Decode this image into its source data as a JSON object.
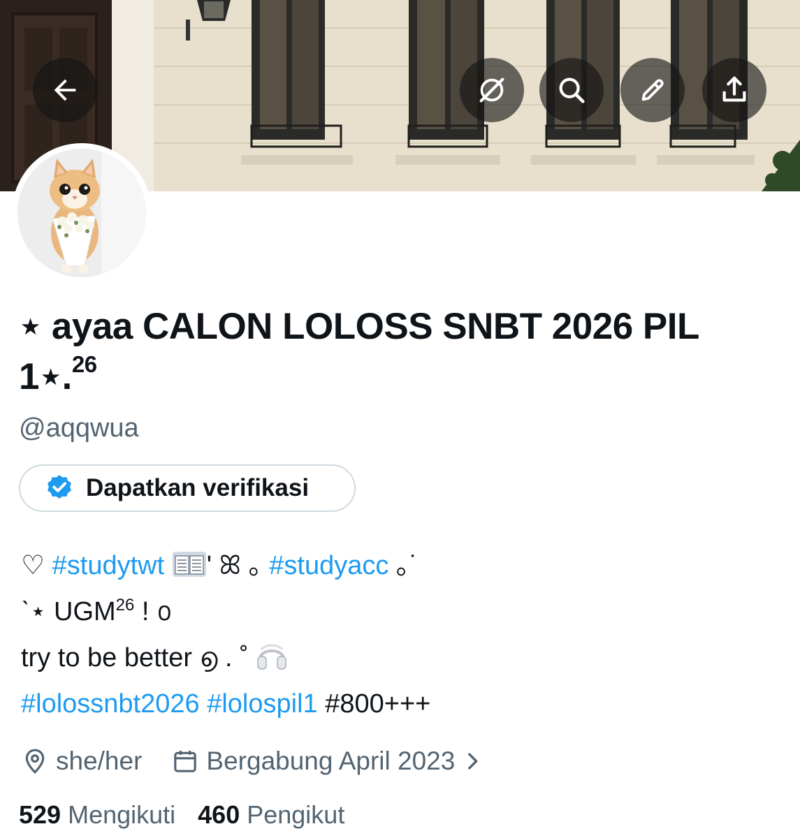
{
  "header": {
    "back_icon": "back-arrow-icon",
    "actions": [
      "grok-slash-icon",
      "search-icon",
      "edit-pencil-icon",
      "share-icon"
    ]
  },
  "profile": {
    "display_name": "⋆ ayaa CALON LOLOSS SNBT 2026 PIL 1⋆.",
    "display_name_sup": "26",
    "handle": "@aqqwua",
    "verify_label": "Dapatkan verifikasi"
  },
  "bio": {
    "line1": {
      "heart": "♡",
      "tag1": "#studytwt",
      "mid": "' ꕤ ｡",
      "tag2": "#studyacc",
      "tail": "｡˙"
    },
    "line2": {
      "prefix": "ˋ⋆ UGM",
      "sup": "26",
      "suffix": "! ൦"
    },
    "line3": {
      "text": "try to be better ൭ . ˚"
    },
    "line4": {
      "tag1": "#lolossnbt2026",
      "tag2": "#lolospil1",
      "plain": "#800+++"
    }
  },
  "meta": {
    "location": "she/her",
    "joined": "Bergabung April 2023"
  },
  "stats": {
    "following_count": "529",
    "following_label": "Mengikuti",
    "followers_count": "460",
    "followers_label": "Pengikut"
  },
  "colors": {
    "accent": "#1d9bf0",
    "secondary_text": "#536471",
    "primary_text": "#0f1419",
    "border": "#cfd9de"
  }
}
